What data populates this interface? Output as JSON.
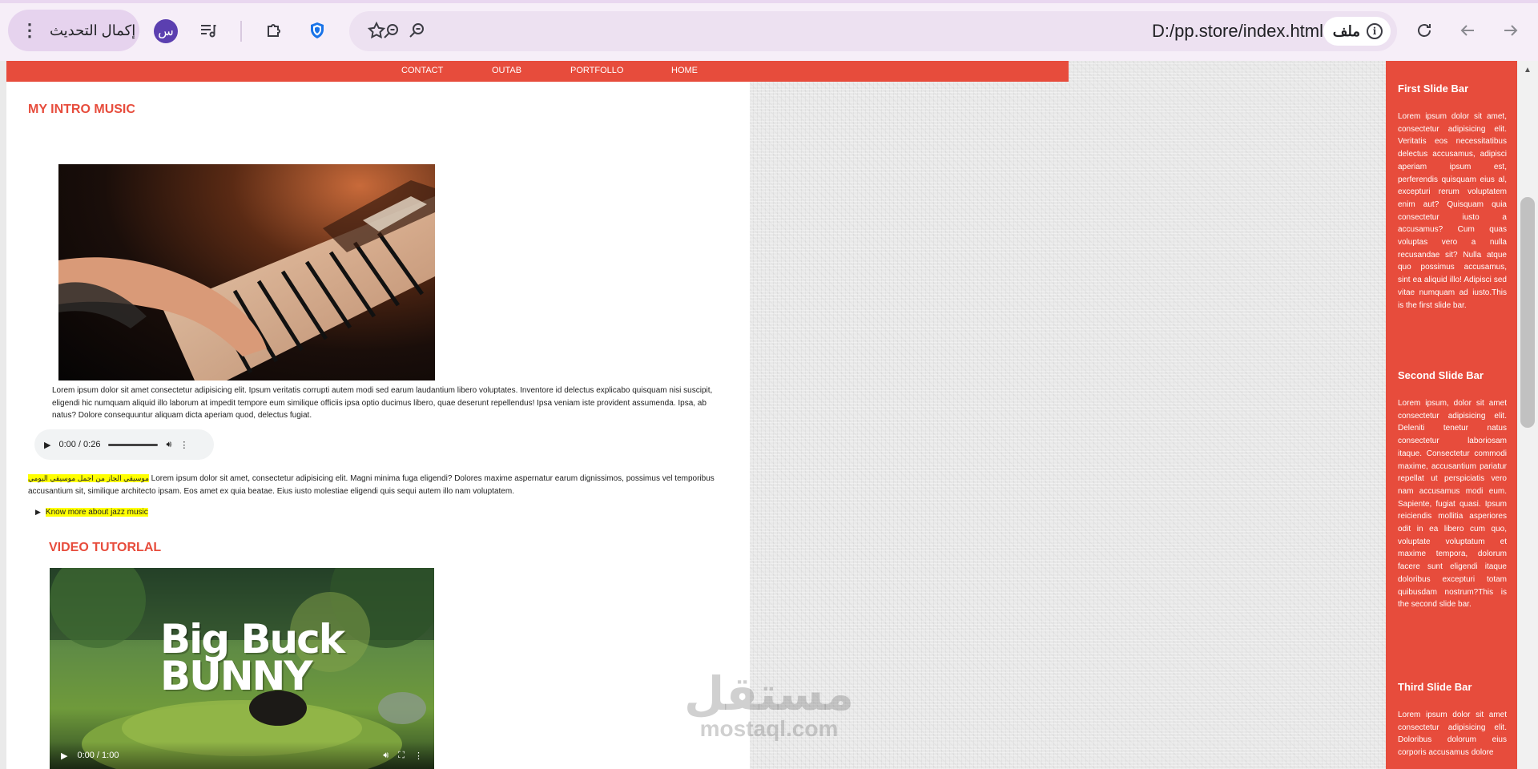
{
  "browser": {
    "update_label": "إكمال التحديث",
    "profile_initial": "س",
    "site_chip_label": "ملف",
    "url": "D:/pp.store/index.html"
  },
  "nav": {
    "items": [
      "CONTACT",
      "OUTAB",
      "PORTFOLLO",
      "HOME"
    ]
  },
  "intro": {
    "title": "MY INTRO MUSIC",
    "paragraph": "Lorem ipsum dolor sit amet consectetur adipisicing elit. Ipsum veritatis corrupti autem modi sed earum laudantium libero voluptates. Inventore id delectus explicabo quisquam nisi suscipit, eligendi hic numquam aliquid illo laborum at impedit tempore eum similique officiis ipsa optio ducimus libero, quae deserunt repellendus! Ipsa veniam iste provident assumenda. Ipsa, ab natus? Dolore consequuntur aliquam dicta aperiam quod, delectus fugiat.",
    "audio_time": "0:00 / 0:26",
    "arabic_highlight": "موسيقي الجاز من اجمل موسيقي اليومي",
    "paragraph2": "Lorem ipsum dolor sit amet, consectetur adipisicing elit. Magni minima fuga eligendi? Dolores maxime aspernatur earum dignissimos, possimus vel temporibus accusantium sit, similique architecto ipsam. Eos amet ex quia beatae. Eius iusto molestiae eligendi quis sequi autem illo nam voluptatem.",
    "details_summary": "Know more about jazz music"
  },
  "video": {
    "title": "VIDEO TUTORLAL",
    "art_line1": "Big Buck",
    "art_line2": "BUNNY",
    "time": "0:00 / 1:00"
  },
  "sidebar": {
    "sections": [
      {
        "title": "First Slide Bar",
        "text": "Lorem ipsum dolor sit amet, consectetur adipisicing elit. Veritatis eos necessitatibus delectus accusamus, adipisci aperiam ipsum est, perferendis quisquam eius al, excepturi rerum voluptatem enim aut? Quisquam quia consectetur iusto a accusamus? Cum quas voluptas vero a nulla recusandae sit? Nulla atque quo possimus accusamus, sint ea aliquid illo! Adipisci sed vitae numquam ad iusto.This is the first slide bar."
      },
      {
        "title": "Second Slide Bar",
        "text": "Lorem ipsum, dolor sit amet consectetur adipisicing elit. Deleniti tenetur natus consectetur laboriosam itaque. Consectetur commodi maxime, accusantium pariatur repellat ut perspiciatis vero nam accusamus modi eum. Sapiente, fugiat quasi. Ipsum reiciendis mollitia asperiores odit in ea libero cum quo, voluptate voluptatum et maxime tempora, dolorum facere sunt eligendi itaque doloribus excepturi totam quibusdam nostrum?This is the second slide bar."
      },
      {
        "title": "Third Slide Bar",
        "text": "Lorem ipsum dolor sit amet consectetur adipisicing elit. Doloribus dolorum eius corporis accusamus dolore"
      }
    ]
  },
  "watermark": {
    "arabic": "مستقل",
    "latin": "mostaql.com"
  },
  "colors": {
    "accent": "#e74c3c",
    "highlight": "#ffff00",
    "chrome_bg": "#f6eef8"
  }
}
